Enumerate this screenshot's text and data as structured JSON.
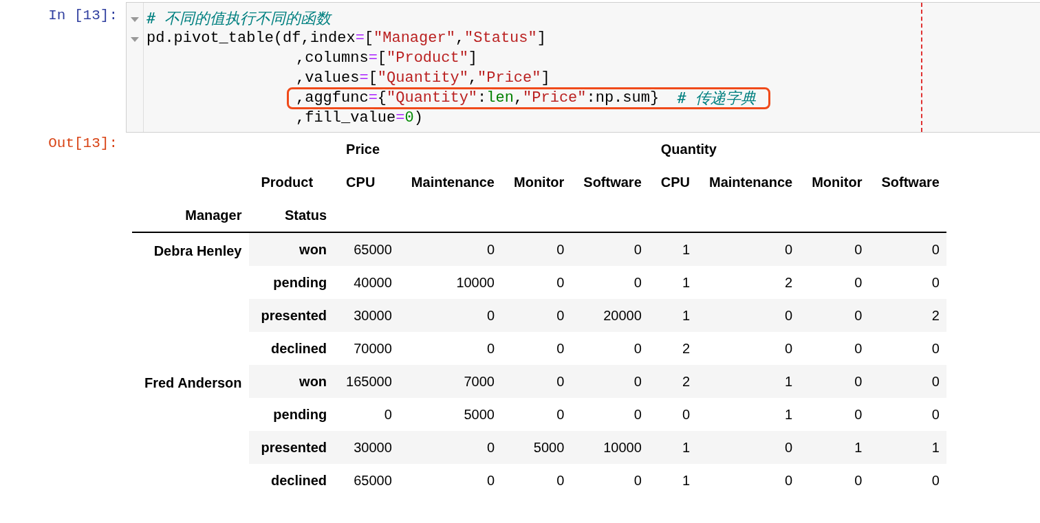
{
  "input_cell": {
    "prompt": "In [13]:",
    "lines": [
      {
        "kind": "statement",
        "folded_marker": true,
        "highlighted": false,
        "tokens": [
          {
            "kind": "comment",
            "text": "# 不同的值执行不同的函数"
          }
        ]
      },
      {
        "kind": "statement",
        "folded_marker": true,
        "highlighted": false,
        "tokens": [
          {
            "kind": "plain",
            "text": "pd.pivot_table(df,index"
          },
          {
            "kind": "op",
            "text": "="
          },
          {
            "kind": "plain",
            "text": "["
          },
          {
            "kind": "string",
            "text": "\"Manager\""
          },
          {
            "kind": "plain",
            "text": ","
          },
          {
            "kind": "string",
            "text": "\"Status\""
          },
          {
            "kind": "plain",
            "text": "]"
          }
        ]
      },
      {
        "kind": "continuation",
        "folded_marker": false,
        "highlighted": false,
        "tokens": [
          {
            "kind": "plain",
            "text": ",columns"
          },
          {
            "kind": "op",
            "text": "="
          },
          {
            "kind": "plain",
            "text": "["
          },
          {
            "kind": "string",
            "text": "\"Product\""
          },
          {
            "kind": "plain",
            "text": "]"
          }
        ]
      },
      {
        "kind": "continuation",
        "folded_marker": false,
        "highlighted": false,
        "tokens": [
          {
            "kind": "plain",
            "text": ",values"
          },
          {
            "kind": "op",
            "text": "="
          },
          {
            "kind": "plain",
            "text": "["
          },
          {
            "kind": "string",
            "text": "\"Quantity\""
          },
          {
            "kind": "plain",
            "text": ","
          },
          {
            "kind": "string",
            "text": "\"Price\""
          },
          {
            "kind": "plain",
            "text": "]"
          }
        ]
      },
      {
        "kind": "continuation",
        "folded_marker": false,
        "highlighted": true,
        "tokens": [
          {
            "kind": "plain",
            "text": ",aggfunc"
          },
          {
            "kind": "op",
            "text": "="
          },
          {
            "kind": "plain",
            "text": "{"
          },
          {
            "kind": "string",
            "text": "\"Quantity\""
          },
          {
            "kind": "plain",
            "text": ":"
          },
          {
            "kind": "builtin",
            "text": "len"
          },
          {
            "kind": "plain",
            "text": ","
          },
          {
            "kind": "string",
            "text": "\"Price\""
          },
          {
            "kind": "plain",
            "text": ":np.sum}  "
          },
          {
            "kind": "comment",
            "text": "# 传递字典"
          }
        ]
      },
      {
        "kind": "continuation",
        "folded_marker": false,
        "highlighted": false,
        "tokens": [
          {
            "kind": "plain",
            "text": ",fill_value"
          },
          {
            "kind": "op",
            "text": "="
          },
          {
            "kind": "number",
            "text": "0"
          },
          {
            "kind": "plain",
            "text": ")"
          }
        ]
      }
    ]
  },
  "output_cell": {
    "prompt": "Out[13]:",
    "table": {
      "value_groups": [
        "Price",
        "Quantity"
      ],
      "columns_name": "Product",
      "columns": [
        "CPU",
        "Maintenance",
        "Monitor",
        "Software",
        "CPU",
        "Maintenance",
        "Monitor",
        "Software"
      ],
      "index_names": [
        "Manager",
        "Status"
      ],
      "groups": [
        {
          "manager": "Debra Henley",
          "rows": [
            {
              "status": "won",
              "values": [
                "65000",
                "0",
                "0",
                "0",
                "1",
                "0",
                "0",
                "0"
              ]
            },
            {
              "status": "pending",
              "values": [
                "40000",
                "10000",
                "0",
                "0",
                "1",
                "2",
                "0",
                "0"
              ]
            },
            {
              "status": "presented",
              "values": [
                "30000",
                "0",
                "0",
                "20000",
                "1",
                "0",
                "0",
                "2"
              ]
            },
            {
              "status": "declined",
              "values": [
                "70000",
                "0",
                "0",
                "0",
                "2",
                "0",
                "0",
                "0"
              ]
            }
          ]
        },
        {
          "manager": "Fred Anderson",
          "rows": [
            {
              "status": "won",
              "values": [
                "165000",
                "7000",
                "0",
                "0",
                "2",
                "1",
                "0",
                "0"
              ]
            },
            {
              "status": "pending",
              "values": [
                "0",
                "5000",
                "0",
                "0",
                "0",
                "1",
                "0",
                "0"
              ]
            },
            {
              "status": "presented",
              "values": [
                "30000",
                "0",
                "5000",
                "10000",
                "1",
                "0",
                "1",
                "1"
              ]
            },
            {
              "status": "declined",
              "values": [
                "65000",
                "0",
                "0",
                "0",
                "1",
                "0",
                "0",
                "0"
              ]
            }
          ]
        }
      ]
    }
  }
}
